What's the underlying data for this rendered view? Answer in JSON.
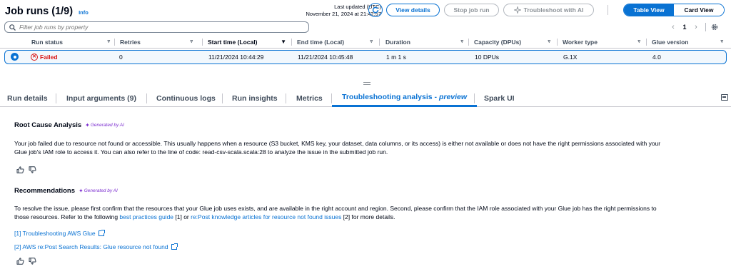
{
  "header": {
    "title": "Job runs (1/9)",
    "info_label": "Info",
    "last_updated_label": "Last updated (UTC)",
    "last_updated_value": "November 21, 2024 at 21:42:57",
    "view_details": "View details",
    "stop_job_run": "Stop job run",
    "troubleshoot_ai": "Troubleshoot with AI",
    "table_view": "Table View",
    "card_view": "Card View"
  },
  "filter": {
    "placeholder": "Filter job runs by property"
  },
  "pagination": {
    "current_page": "1",
    "prev_icon": "chevron-left-icon",
    "next_icon": "chevron-right-icon"
  },
  "table": {
    "columns": [
      "Run status",
      "Retries",
      "Start time (Local)",
      "End time (Local)",
      "Duration",
      "Capacity (DPUs)",
      "Worker type",
      "Glue version"
    ],
    "rows": [
      {
        "status": "Failed",
        "retries": "0",
        "start": "11/21/2024 10:44:29",
        "end": "11/21/2024 10:45:48",
        "duration": "1 m 1 s",
        "capacity": "10 DPUs",
        "worker": "G.1X",
        "glue_version": "4.0"
      }
    ]
  },
  "tabs": [
    {
      "label": "Run details"
    },
    {
      "label": "Input arguments (9)"
    },
    {
      "label": "Continuous logs"
    },
    {
      "label": "Run insights"
    },
    {
      "label": "Metrics"
    },
    {
      "label": "Troubleshooting analysis - ",
      "suffix": "preview"
    },
    {
      "label": "Spark UI"
    }
  ],
  "analysis": {
    "root_cause_title": "Root Cause Analysis",
    "generated_by_ai": "Generated by AI",
    "root_cause_line1": "Your job failed due to resource not found or accessible. This usually happens when a resource (S3 bucket, KMS key, your dataset, data columns, or its access) is either not available or does not have the right permissions associated with your",
    "root_cause_line2": "Glue job's IAM role to access it. You can also refer to the line of code: read-csv-scala.scala:28 to analyze the issue in the submitted job run.",
    "recommendations_title": "Recommendations",
    "rec_line1": "To resolve the issue, please first confirm that the resources that your Glue job uses exists, and are available in the right account and region. Second, please confirm that the IAM role associated with your Glue job has the right permissions to",
    "rec_line2_a": "those resources. Refer to the following ",
    "rec_link1": "best practices guide",
    "rec_line2_b": " [1] or ",
    "rec_link2": "re:Post knowledge articles for resource not found issues",
    "rec_line2_c": " [2] for more details.",
    "ref1": "[1] Troubleshooting AWS Glue",
    "ref2": "[2] AWS re:Post Search Results: Glue resource not found"
  },
  "colors": {
    "accent": "#0972d3",
    "error": "#d91515",
    "ai": "#7d2fd0",
    "row_selected_bg": "#f2f8fd"
  }
}
